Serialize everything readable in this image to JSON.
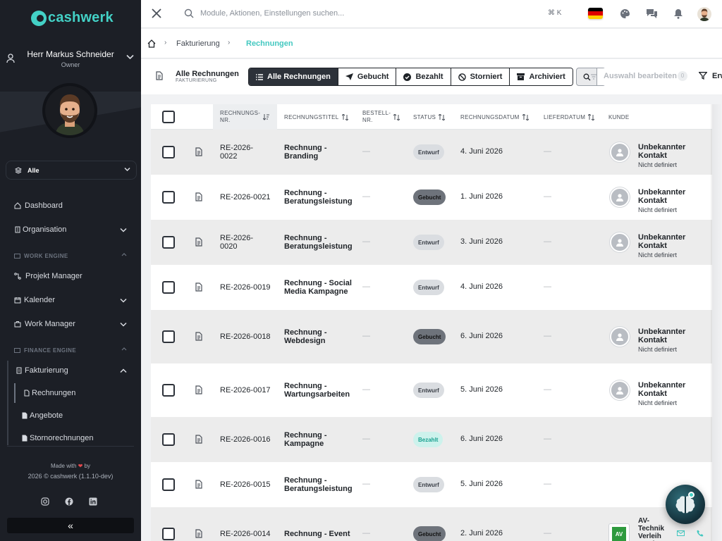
{
  "sidebar": {
    "logo_text": "cashwerk",
    "user_name": "Herr Markus Schneider",
    "user_role": "Owner",
    "scope_selector": "Alle",
    "items": [
      {
        "label": "Dashboard"
      },
      {
        "label": "Organisation"
      },
      {
        "label": "Projekt Manager"
      },
      {
        "label": "Kalender"
      },
      {
        "label": "Work Manager"
      },
      {
        "label": "Fakturierung"
      },
      {
        "label": "Rechnungen"
      },
      {
        "label": "Angebote"
      },
      {
        "label": "Stornorechnungen"
      }
    ],
    "sections": {
      "work_engine": "WORK ENGINE",
      "finance_engine": "FINANCE ENGINE"
    },
    "footer": {
      "made_with": "Made with",
      "made_by": "by",
      "copyright": "2026 © cashwerk (1.1.10-dev)"
    },
    "collapse_label": "«"
  },
  "topbar": {
    "search_placeholder": "Module, Aktionen, Einstellungen suchen...",
    "shortcut": "⌘ K"
  },
  "breadcrumb": {
    "items": [
      "Fakturierung",
      "Rechnungen"
    ]
  },
  "toolbar": {
    "title": "Alle Rechnungen",
    "subtitle": "FAKTURIERUNG",
    "segments": [
      {
        "label": "Alle Rechnungen",
        "icon": "list-icon",
        "active": true
      },
      {
        "label": "Gebucht",
        "icon": "send-icon",
        "active": false
      },
      {
        "label": "Bezahlt",
        "icon": "check-circle-icon",
        "active": false
      },
      {
        "label": "Storniert",
        "icon": "cancel-icon",
        "active": false
      },
      {
        "label": "Archiviert",
        "icon": "archive-icon",
        "active": false
      }
    ],
    "edit_selection": "Auswahl bearbeiten",
    "selection_count": "0",
    "extended": "Erw"
  },
  "table": {
    "columns": {
      "nr": "RECHNUNGS-\nNR.",
      "title": "RECHNUNGSTITEL",
      "order": "BESTELL-\nNR.",
      "status": "STATUS",
      "date": "RECHNUNGSDATUM",
      "delivery": "LIEFERDATUM",
      "customer": "KUNDE"
    },
    "rows": [
      {
        "nr": "RE-2026-\n0022",
        "title": "Rechnung -\nBranding",
        "order": "—",
        "status": "Entwurf",
        "date": "4. Juni 2026",
        "delivery": "—",
        "customer": "Unbekannter Kontakt",
        "customer_sub": "Nicht definiert"
      },
      {
        "nr": "RE-2026-0021",
        "title": "Rechnung -\nBeratungsleistung",
        "order": "—",
        "status": "Gebucht",
        "date": "1. Juni 2026",
        "delivery": "—",
        "customer": "Unbekannter Kontakt",
        "customer_sub": "Nicht definiert"
      },
      {
        "nr": "RE-2026-\n0020",
        "title": "Rechnung -\nBeratungsleistung",
        "order": "—",
        "status": "Entwurf",
        "date": "3. Juni 2026",
        "delivery": "—",
        "customer": "Unbekannter Kontakt",
        "customer_sub": "Nicht definiert"
      },
      {
        "nr": "RE-2026-0019",
        "title": "Rechnung - Social\nMedia Kampagne",
        "order": "—",
        "status": "Entwurf",
        "date": "4. Juni 2026",
        "delivery": "—",
        "customer": "",
        "customer_sub": ""
      },
      {
        "nr": "RE-2026-0018",
        "title": "Rechnung -\nWebdesign",
        "order": "—",
        "status": "Gebucht",
        "date": "6. Juni 2026",
        "delivery": "—",
        "customer": "Unbekannter Kontakt",
        "customer_sub": "Nicht definiert"
      },
      {
        "nr": "RE-2026-0017",
        "title": "Rechnung -\nWartungsarbeiten",
        "order": "—",
        "status": "Entwurf",
        "date": "5. Juni 2026",
        "delivery": "—",
        "customer": "Unbekannter Kontakt",
        "customer_sub": "Nicht definiert"
      },
      {
        "nr": "RE-2026-0016",
        "title": "Rechnung -\nKampagne",
        "order": "—",
        "status": "Bezahlt",
        "date": "6. Juni 2026",
        "delivery": "—",
        "customer": "",
        "customer_sub": ""
      },
      {
        "nr": "RE-2026-0015",
        "title": "Rechnung -\nBeratungsleistung",
        "order": "—",
        "status": "Entwurf",
        "date": "5. Juni 2026",
        "delivery": "—",
        "customer": "",
        "customer_sub": ""
      },
      {
        "nr": "RE-2026-0014",
        "title": "Rechnung - Event",
        "order": "—",
        "status": "Gebucht",
        "date": "2. Juni 2026",
        "delivery": "—",
        "customer": "AV-\nTechnik\nVerleih\nNord",
        "customer_sub": "",
        "customer_logo": "AV"
      }
    ]
  },
  "colors": {
    "accent": "#43d1c6",
    "sidebar_bg": "#1c1f26",
    "active_segment": "#2d323a",
    "badge_bezahlt": "#1aa291"
  }
}
